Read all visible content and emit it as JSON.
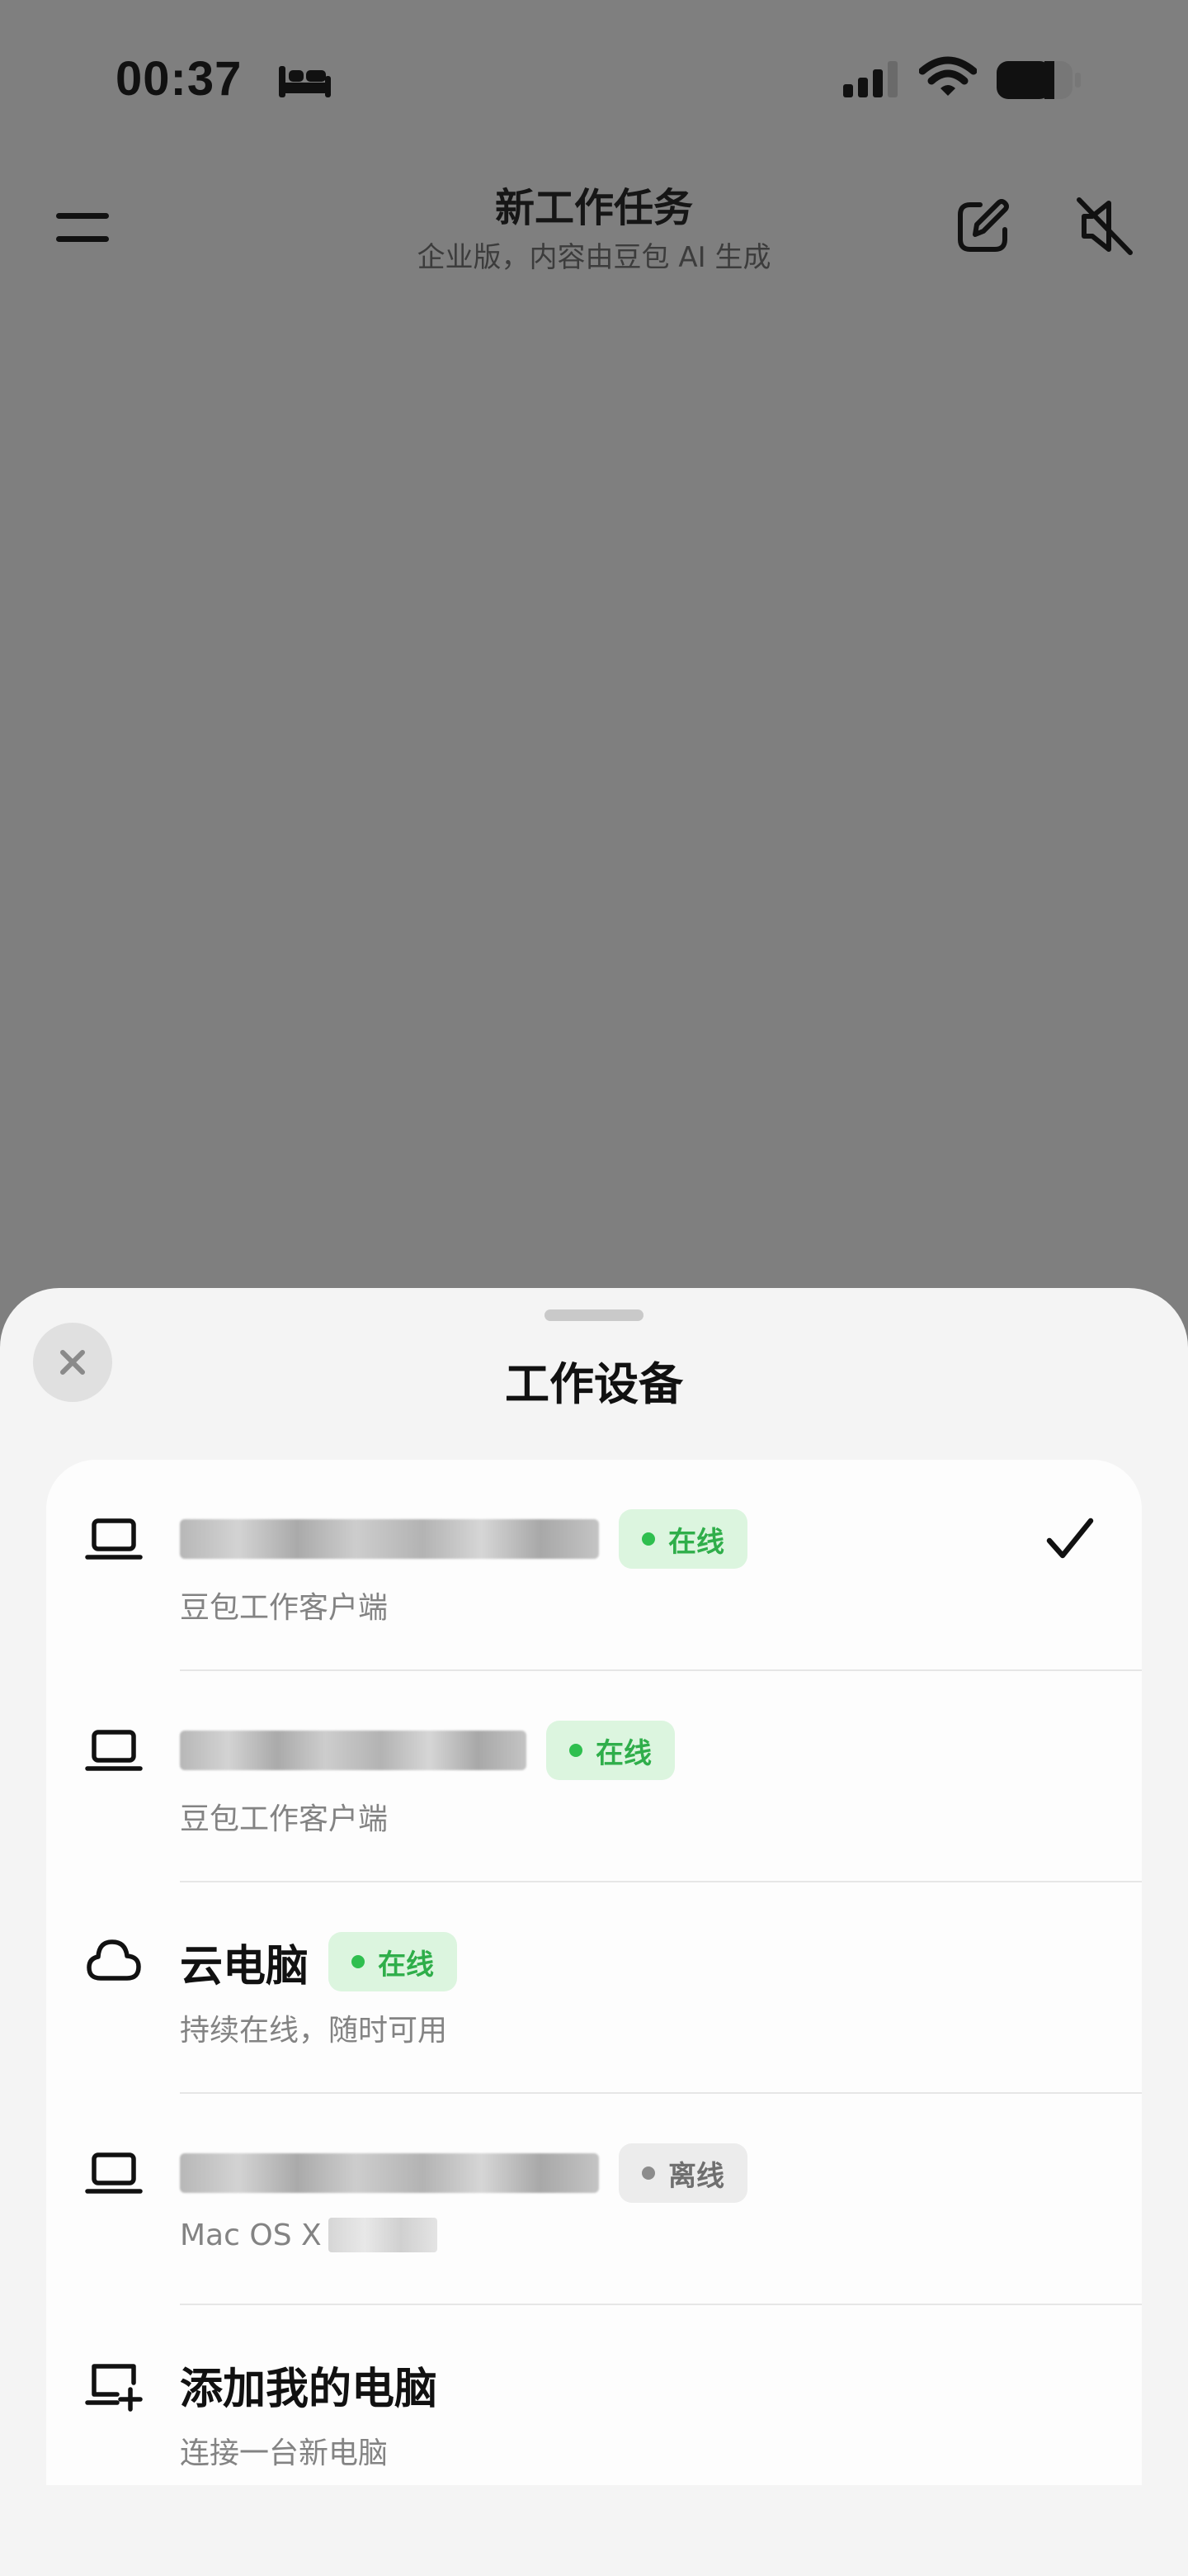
{
  "status_bar": {
    "time": "00:37",
    "icons": [
      "sleep-focus-icon",
      "cellular-signal-icon",
      "wifi-icon",
      "battery-icon"
    ]
  },
  "header": {
    "title": "新工作任务",
    "subtitle": "企业版，内容由豆包 AI 生成",
    "icons": {
      "menu": "menu-icon",
      "new_task": "compose-icon",
      "mute": "speaker-mute-icon"
    }
  },
  "sheet": {
    "title": "工作设备",
    "close_icon": "close-icon",
    "devices": [
      {
        "icon": "laptop-icon",
        "name": "",
        "name_redacted": true,
        "status": "在线",
        "status_state": "online",
        "subtitle": "豆包工作客户端",
        "selected": true
      },
      {
        "icon": "laptop-icon",
        "name": "",
        "name_redacted": true,
        "status": "在线",
        "status_state": "online",
        "subtitle": "豆包工作客户端",
        "selected": false
      },
      {
        "icon": "cloud-icon",
        "name": "云电脑",
        "name_redacted": false,
        "status": "在线",
        "status_state": "online",
        "subtitle": "持续在线，随时可用",
        "selected": false
      },
      {
        "icon": "laptop-icon",
        "name": "",
        "name_redacted": true,
        "status": "离线",
        "status_state": "offline",
        "subtitle": "Mac OS X",
        "selected": false
      }
    ],
    "add_device": {
      "icon": "add-computer-icon",
      "name": "添加我的电脑",
      "subtitle": "连接一台新电脑"
    }
  },
  "colors": {
    "online_text": "#2fae4a",
    "online_bg": "#dcf5df",
    "offline_text": "#6f6f6f",
    "offline_bg": "#ececec",
    "overlay": "#7f7f7f",
    "sheet_bg": "#f4f4f4"
  }
}
